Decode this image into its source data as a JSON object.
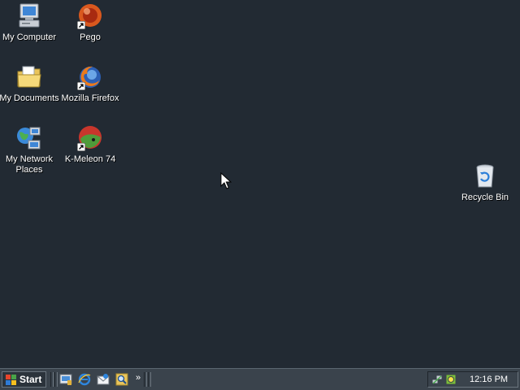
{
  "desktop": {
    "icons": [
      {
        "label": "My Computer",
        "icon": "my-computer-icon"
      },
      {
        "label": "Pego",
        "icon": "pego-icon"
      },
      {
        "label": "My Documents",
        "icon": "folder-documents-icon"
      },
      {
        "label": "Mozilla Firefox",
        "icon": "firefox-icon"
      },
      {
        "label": "My Network Places",
        "icon": "network-places-icon"
      },
      {
        "label": "K-Meleon 74",
        "icon": "kmeleon-icon"
      },
      {
        "label": "Recycle Bin",
        "icon": "recycle-bin-icon"
      }
    ]
  },
  "taskbar": {
    "start_label": "Start",
    "quicklaunch": [
      "show-desktop-icon",
      "internet-explorer-icon",
      "outlook-express-icon",
      "search-icon"
    ],
    "more_glyph": "»",
    "clock": "12:16 PM",
    "tray_icons": [
      "network-icon",
      "security-icon"
    ]
  },
  "colors": {
    "desktop_bg": "#222a33",
    "taskbar_bg": "#3a434c"
  }
}
